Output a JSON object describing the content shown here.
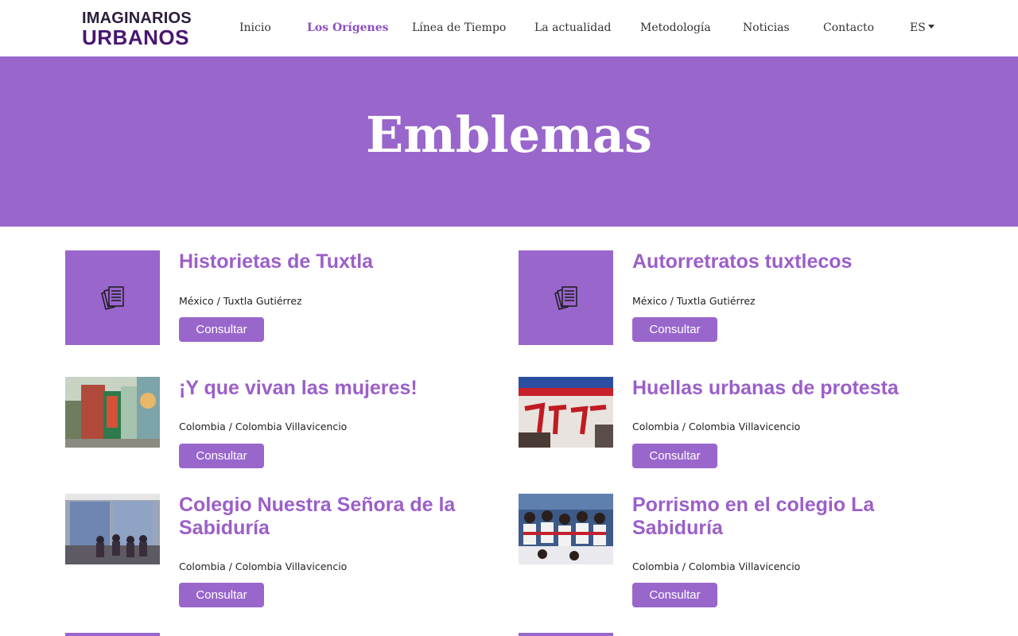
{
  "brand": {
    "line1": "IMAGINARIOS",
    "line2": "URBANOS"
  },
  "nav": {
    "items": [
      "Inicio",
      "Los Orígenes",
      "Línea de Tiempo",
      "La actualidad",
      "Metodología",
      "Noticias",
      "Contacto"
    ],
    "active_index": 1,
    "language": "ES"
  },
  "hero": {
    "title": "Emblemas"
  },
  "colors": {
    "accent": "#9966cc",
    "title": "#9b5fc9",
    "brand_dark": "#4a1670"
  },
  "cards": [
    {
      "title": "Historietas de Tuxtla",
      "location": "México / Tuxtla Gutiérrez",
      "button": "Consultar",
      "thumb": "document-stack-icon"
    },
    {
      "title": "Autorretratos tuxtlecos",
      "location": "México / Tuxtla Gutiérrez",
      "button": "Consultar",
      "thumb": "document-stack-icon"
    },
    {
      "title": "¡Y que vivan las mujeres!",
      "location": "Colombia / Colombia Villavicencio",
      "button": "Consultar",
      "thumb": "street-kiosk-photo"
    },
    {
      "title": "Huellas urbanas de protesta",
      "location": "Colombia / Colombia Villavicencio",
      "button": "Consultar",
      "thumb": "protest-graffiti-photo"
    },
    {
      "title_line1": "Colegio Nuestra Señora de la",
      "title_line2": "Sabiduría",
      "location": "Colombia / Colombia Villavicencio",
      "button": "Consultar",
      "thumb": "classroom-photo"
    },
    {
      "title_line1": "Porrismo en el colegio La",
      "title_line2": "Sabiduría",
      "location": "Colombia / Colombia Villavicencio",
      "button": "Consultar",
      "thumb": "cheerleaders-photo"
    }
  ]
}
